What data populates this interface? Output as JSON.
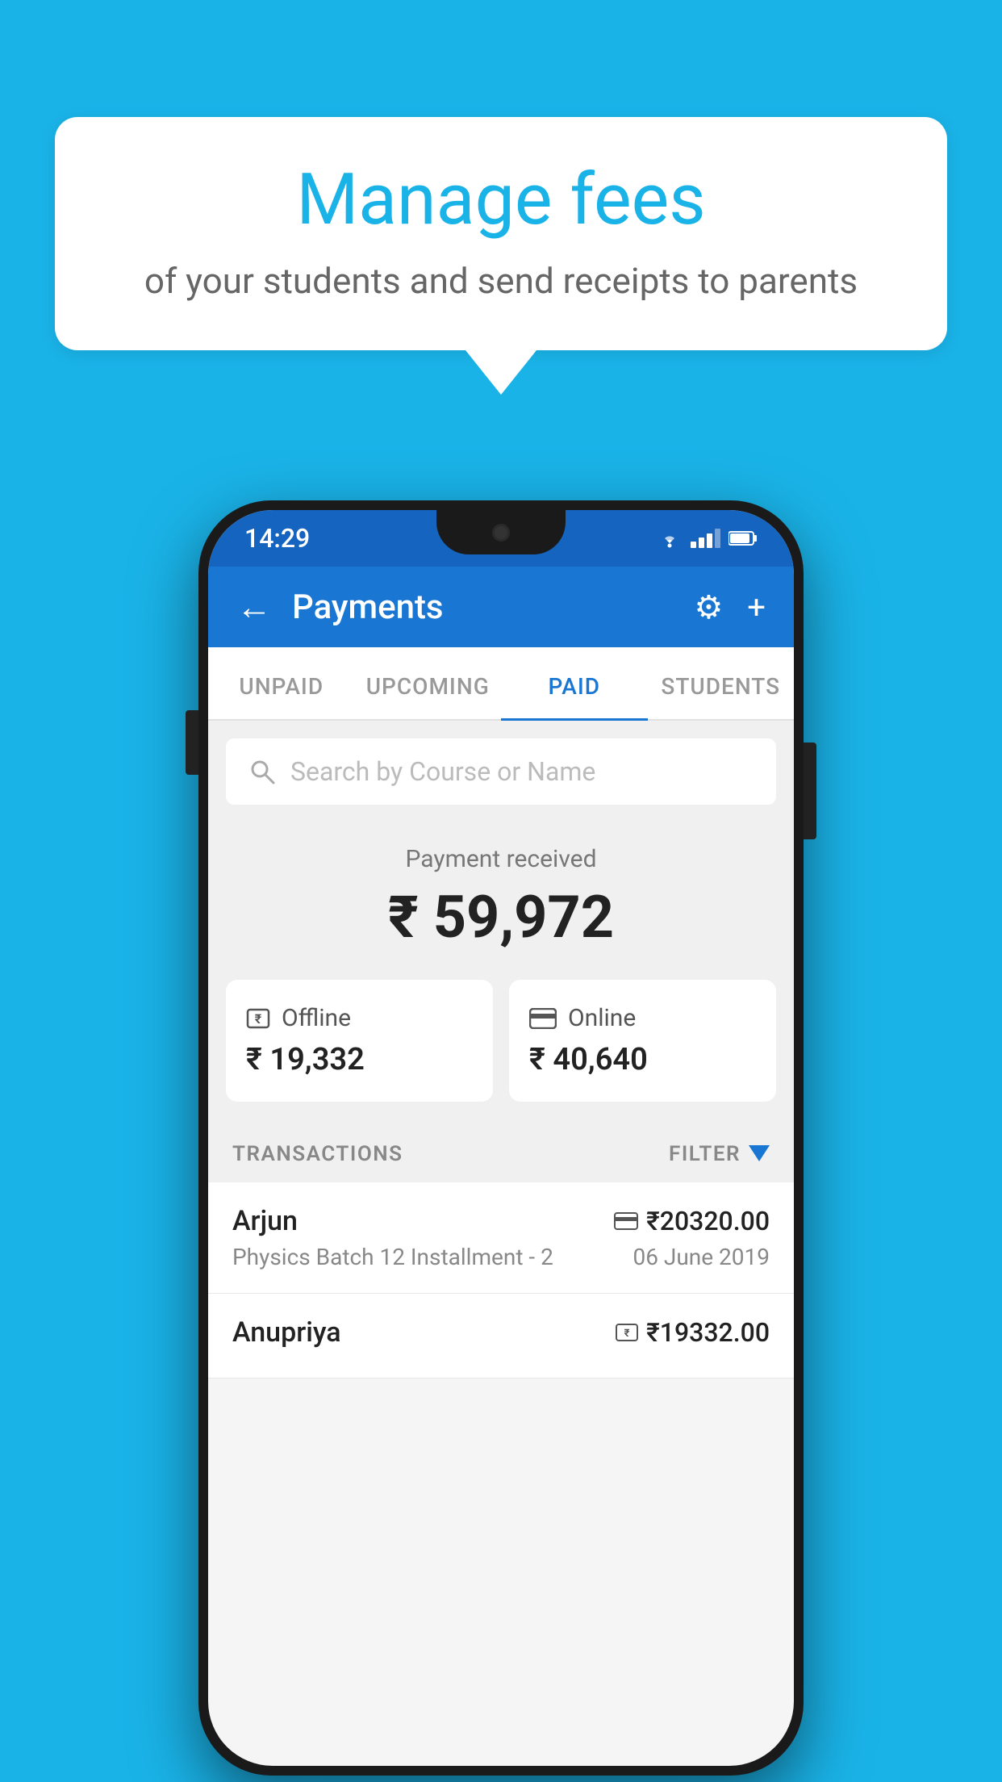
{
  "background_color": "#1ab3e8",
  "speech_bubble": {
    "title": "Manage fees",
    "subtitle": "of your students and send receipts to parents"
  },
  "status_bar": {
    "time": "14:29"
  },
  "app_bar": {
    "title": "Payments",
    "back_label": "←",
    "gear_label": "⚙",
    "plus_label": "+"
  },
  "tabs": [
    {
      "label": "UNPAID",
      "active": false
    },
    {
      "label": "UPCOMING",
      "active": false
    },
    {
      "label": "PAID",
      "active": true
    },
    {
      "label": "STUDENTS",
      "active": false
    }
  ],
  "search": {
    "placeholder": "Search by Course or Name"
  },
  "payment_summary": {
    "label": "Payment received",
    "amount": "₹ 59,972"
  },
  "payment_cards": [
    {
      "type": "Offline",
      "amount": "₹ 19,332",
      "icon": "rupee"
    },
    {
      "type": "Online",
      "amount": "₹ 40,640",
      "icon": "card"
    }
  ],
  "transactions_section": {
    "label": "TRANSACTIONS",
    "filter_label": "FILTER"
  },
  "transactions": [
    {
      "name": "Arjun",
      "course": "Physics Batch 12 Installment - 2",
      "amount": "₹20320.00",
      "date": "06 June 2019",
      "icon": "card"
    },
    {
      "name": "Anupriya",
      "course": "",
      "amount": "₹19332.00",
      "date": "",
      "icon": "rupee"
    }
  ]
}
